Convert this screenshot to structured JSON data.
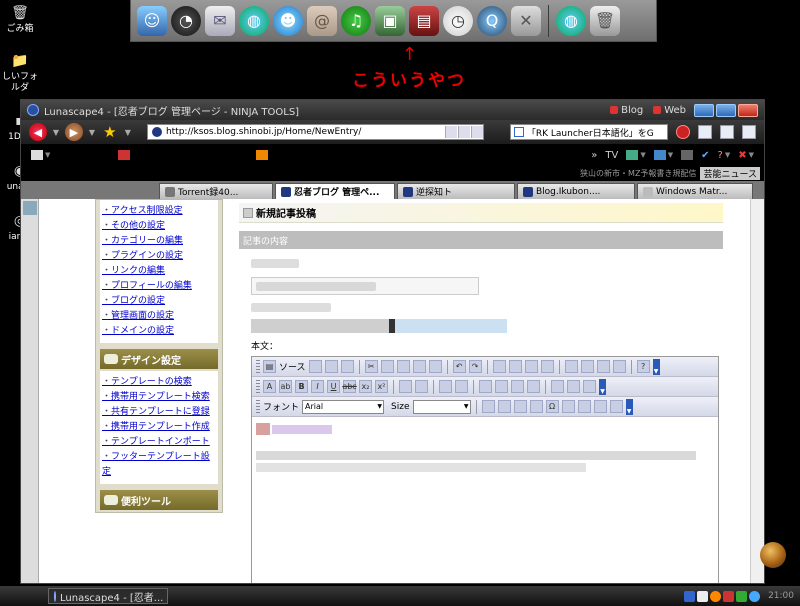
{
  "desktop": {
    "icons": [
      {
        "label": "ごみ箱",
        "glyph": "🗑"
      },
      {
        "label": "しいフォルダ",
        "glyph": "📁"
      },
      {
        "label": "1DSP",
        "glyph": "▪"
      },
      {
        "label": "unasc",
        "glyph": "◉"
      },
      {
        "label": "ianot",
        "glyph": "◎"
      }
    ]
  },
  "dock": {
    "icons": [
      "finder-icon",
      "dashboard-icon",
      "mail-icon",
      "browser-icon",
      "ichat-icon",
      "address-book-icon",
      "itunes-icon",
      "iphoto-icon",
      "imovie-icon",
      "clock-icon",
      "quicktime-icon",
      "utility-icon",
      "browser-icon",
      "trash-icon"
    ]
  },
  "annotation": {
    "arrow": "↑",
    "text": "こういうやつ"
  },
  "window": {
    "title": "Lunascape4 - [忍者ブログ 管理ページ - NINJA TOOLS]",
    "links": [
      "Blog",
      "Web"
    ],
    "address": "http://ksos.blog.shinobi.jp/Home/NewEntry/",
    "search_text": "「RK Launcher日本語化」をG",
    "info_text": "狭山の新市・MZ予報書き規配信",
    "news_button": "芸能ニュース",
    "tabs": [
      {
        "label": "Torrent録40...",
        "active": false
      },
      {
        "label": "忍者ブログ 管理ペ...",
        "active": true
      },
      {
        "label": "逆探知ト",
        "active": false
      },
      {
        "label": "Blog.Ikubon....",
        "active": false
      },
      {
        "label": "Windows Matr...",
        "active": false
      }
    ]
  },
  "sidebar": {
    "settings_links": [
      "アクセス制限設定",
      "その他の設定",
      "カテゴリーの編集",
      "プラグインの設定",
      "リンクの編集",
      "プロフィールの編集",
      "ブログの設定",
      "管理画面の設定",
      "ドメインの設定"
    ],
    "design_heading": "デザイン設定",
    "design_links": [
      "テンプレートの検索",
      "携帯用テンプレート検索",
      "共有テンプレートに登録",
      "携帯用テンプレート作成",
      "テンプレートインポート",
      "フッターテンプレート設定"
    ],
    "next_heading": "便利ツール"
  },
  "main": {
    "page_heading": "新規記事投稿",
    "section_heading": "記事の内容",
    "body_label": "本文：",
    "toolbar": {
      "source": "ソース",
      "font_label": "フォント",
      "font_value": "Arial",
      "size_label": "Size",
      "size_value": ""
    }
  },
  "taskbar": {
    "task_label": "Lunascape4 - [忍者...",
    "clock": "21:00",
    "apple": ""
  }
}
